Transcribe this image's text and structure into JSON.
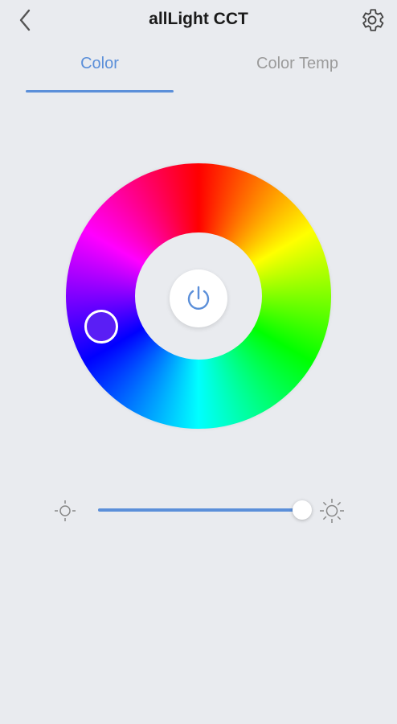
{
  "header": {
    "title": "allLight CCT"
  },
  "tabs": [
    {
      "label": "Color",
      "active": true
    },
    {
      "label": "Color Temp",
      "active": false
    }
  ],
  "colors": {
    "accent": "#5b8fd9",
    "inactive_tab": "#9b9b9b",
    "background": "#e9ebef"
  },
  "color_wheel": {
    "selected_color": "#5a1ef5"
  },
  "brightness": {
    "value_percent": 100
  },
  "icons": {
    "back": "chevron-left-icon",
    "settings": "gear-icon",
    "power": "power-icon",
    "brightness_low": "sun-low-icon",
    "brightness_high": "sun-high-icon"
  }
}
